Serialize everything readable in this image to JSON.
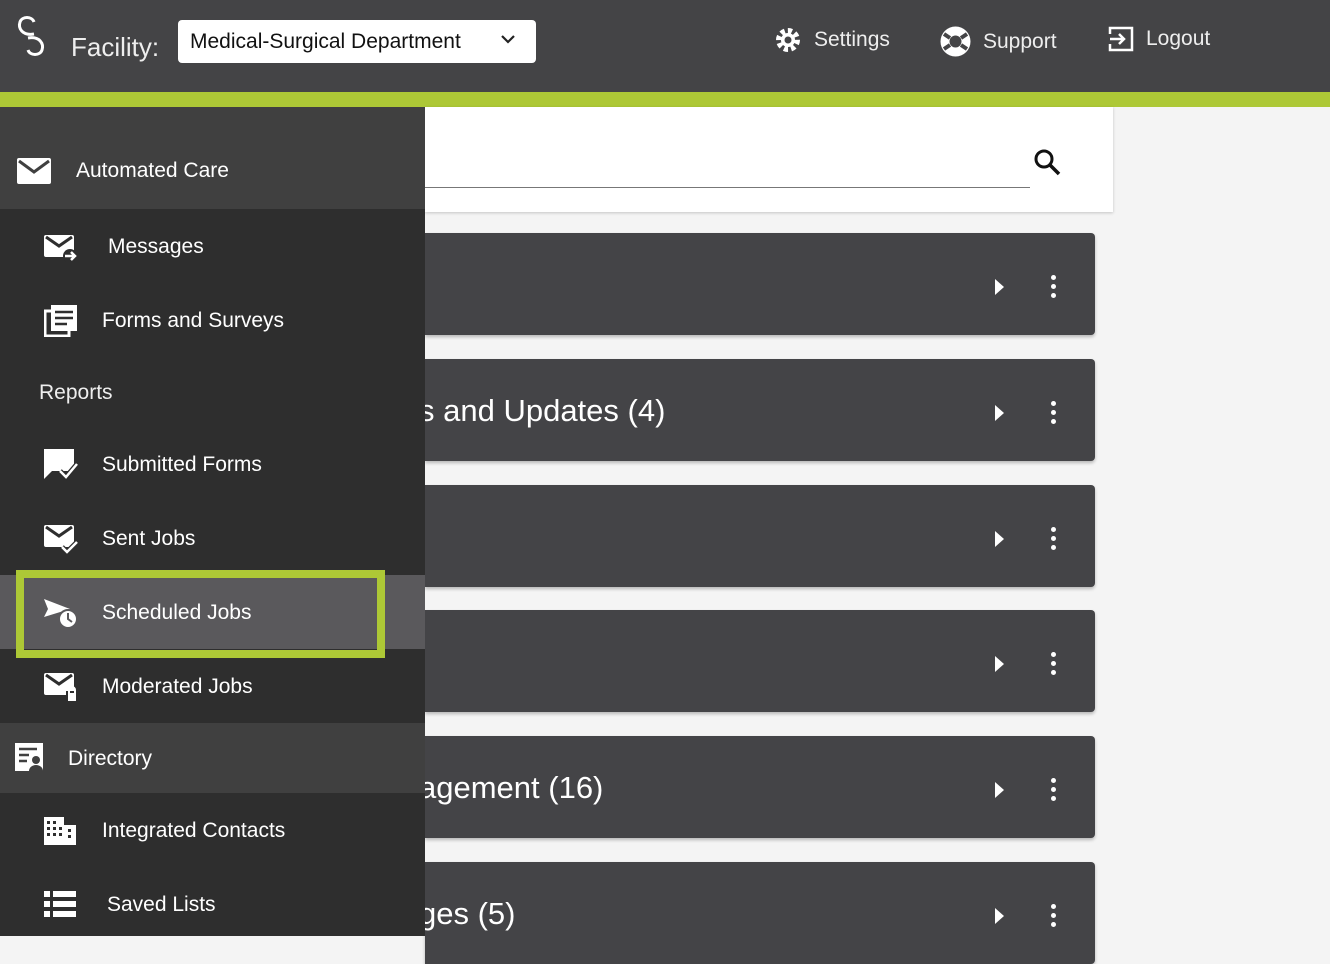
{
  "header": {
    "facility_label": "Facility:",
    "facility_value": "Medical-Surgical Department",
    "settings": "Settings",
    "support": "Support",
    "logout": "Logout"
  },
  "colors": {
    "accent": "#adc836",
    "header": "#444446",
    "sidebar": "#2e2e2e"
  },
  "sidebar": {
    "automated_care": "Automated Care",
    "messages": "Messages",
    "forms_and_surveys": "Forms and Surveys",
    "reports": "Reports",
    "submitted_forms": "Submitted Forms",
    "sent_jobs": "Sent Jobs",
    "scheduled_jobs": "Scheduled Jobs",
    "moderated_jobs": "Moderated Jobs",
    "directory": "Directory",
    "integrated_contacts": "Integrated Contacts",
    "saved_lists": "Saved Lists"
  },
  "cards": [
    "",
    "s and Updates (4)",
    "",
    "",
    "agement (16)",
    "ges (5)"
  ]
}
